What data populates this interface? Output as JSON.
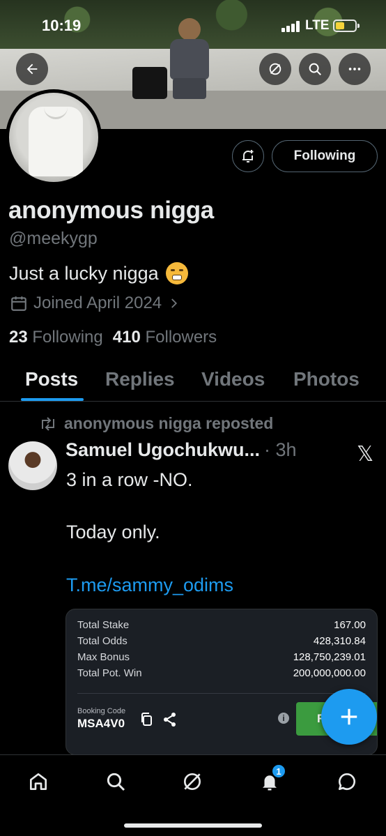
{
  "status_bar": {
    "time": "10:19",
    "network": "LTE"
  },
  "header": {
    "back_icon": "arrow-left-icon",
    "grok_icon": "grok-icon",
    "search_icon": "search-icon",
    "more_icon": "more-icon"
  },
  "profile": {
    "display_name": "anonymous nigga",
    "handle": "@meekygp",
    "bio": "Just a lucky nigga",
    "joined": "Joined April 2024",
    "following_count": "23",
    "following_label": "Following",
    "followers_count": "410",
    "followers_label": "Followers",
    "follow_button_label": "Following"
  },
  "tabs": [
    {
      "label": "Posts",
      "active": true
    },
    {
      "label": "Replies",
      "active": false
    },
    {
      "label": "Videos",
      "active": false
    },
    {
      "label": "Photos",
      "active": false
    }
  ],
  "post": {
    "repost_label": "anonymous nigga reposted",
    "author_name": "Samuel Ugochukwu...",
    "meta": "· 3h",
    "x_logo": "𝕏",
    "lines": [
      "3 in a row -NO.",
      "Today only."
    ],
    "link": "T.me/sammy_odims",
    "bet_slip": {
      "rows": [
        {
          "label": "Total Stake",
          "value": "167.00"
        },
        {
          "label": "Total Odds",
          "value": "428,310.84"
        },
        {
          "label": "Max Bonus",
          "value": "128,750,239.01"
        },
        {
          "label": "Total Pot. Win",
          "value": "200,000,000.00"
        }
      ],
      "booking_label": "Booking Code",
      "booking_code": "MSA4V0",
      "button_label": "R"
    }
  },
  "fab": {
    "icon": "plus-icon"
  },
  "bottom_nav": {
    "items": [
      "home-icon",
      "search-icon",
      "grok-icon",
      "notifications-icon",
      "messages-icon"
    ],
    "notification_badge": "1"
  },
  "colors": {
    "accent": "#1d9bf0",
    "muted": "#71767b",
    "text": "#e7e9ea",
    "green": "#3b9b3f"
  }
}
